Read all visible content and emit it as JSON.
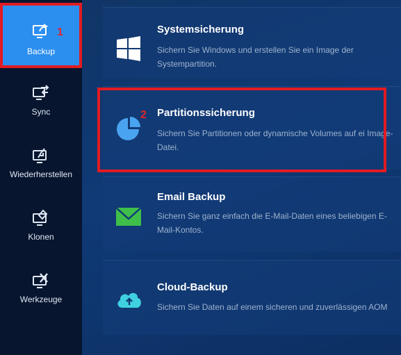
{
  "sidebar": {
    "items": [
      {
        "label": "Backup",
        "icon": "backup-icon",
        "active": true,
        "marker": "1"
      },
      {
        "label": "Sync",
        "icon": "sync-icon"
      },
      {
        "label": "Wiederherstellen",
        "icon": "restore-icon"
      },
      {
        "label": "Klonen",
        "icon": "clone-icon"
      },
      {
        "label": "Werkzeuge",
        "icon": "tools-icon"
      }
    ]
  },
  "main": {
    "options": [
      {
        "title": "Systemsicherung",
        "description": "Sichern Sie Windows und erstellen Sie ein Image der Systempartition.",
        "icon": "windows-icon"
      },
      {
        "title": "Partitionssicherung",
        "description": "Sichern Sie Partitionen oder dynamische Volumes auf ei Image-Datei.",
        "icon": "pie-chart-icon",
        "marker": "2"
      },
      {
        "title": "Email Backup",
        "description": " Sichern Sie ganz einfach die E-Mail-Daten eines beliebigen E-Mail-Kontos.",
        "icon": "envelope-icon"
      },
      {
        "title": "Cloud-Backup",
        "description": "Sichern Sie Daten auf einem sicheren und zuverlässigen AOM",
        "icon": "cloud-upload-icon"
      }
    ]
  },
  "colors": {
    "sidebar_bg": "#07152e",
    "active_bg": "#2b8ff0",
    "main_bg": "#0f3a76",
    "highlight": "#e11b22",
    "envelope": "#3fbf4a",
    "cloud": "#3fd1e0"
  }
}
